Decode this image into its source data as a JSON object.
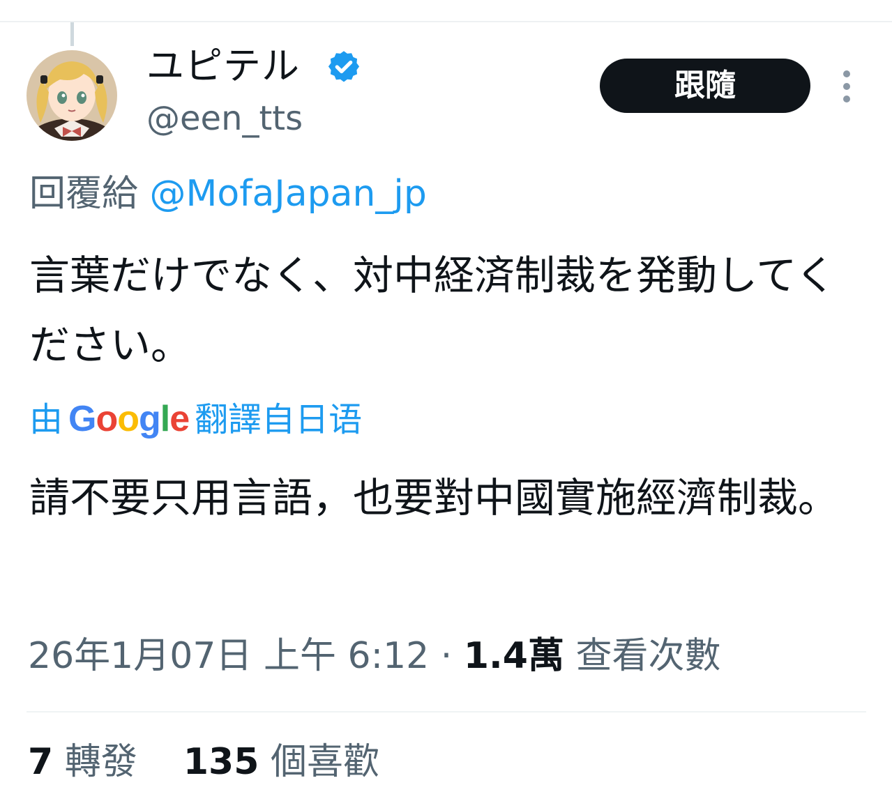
{
  "tweet": {
    "author": {
      "display_name": "ユピテル",
      "handle": "@een_tts",
      "verified": true,
      "verified_color": "#1d9bf0"
    },
    "follow_label": "跟隨",
    "reply_prefix": "回覆給",
    "reply_to": "@MofaJapan_jp",
    "text": "言葉だけでなく、対中経済制裁を発動してください。",
    "translation": {
      "prefix": "由",
      "brand": "Google",
      "suffix": "翻譯自日语",
      "text": "請不要只用言語，也要對中國實施經濟制裁。"
    },
    "timestamp": "26年1月07日 上午 6:12",
    "separator": "·",
    "views_count": "1.4萬",
    "views_label": "查看次數",
    "retweets_count": "7",
    "retweets_label": "轉發",
    "likes_count": "135",
    "likes_label": "個喜歡"
  },
  "colors": {
    "text_primary": "#0f1419",
    "text_secondary": "#536471",
    "link": "#1d9bf0",
    "button_bg": "#0f1419"
  },
  "icons": {
    "verified": "verified-badge-icon",
    "more": "more-vertical-icon",
    "avatar": "anime-avatar"
  }
}
